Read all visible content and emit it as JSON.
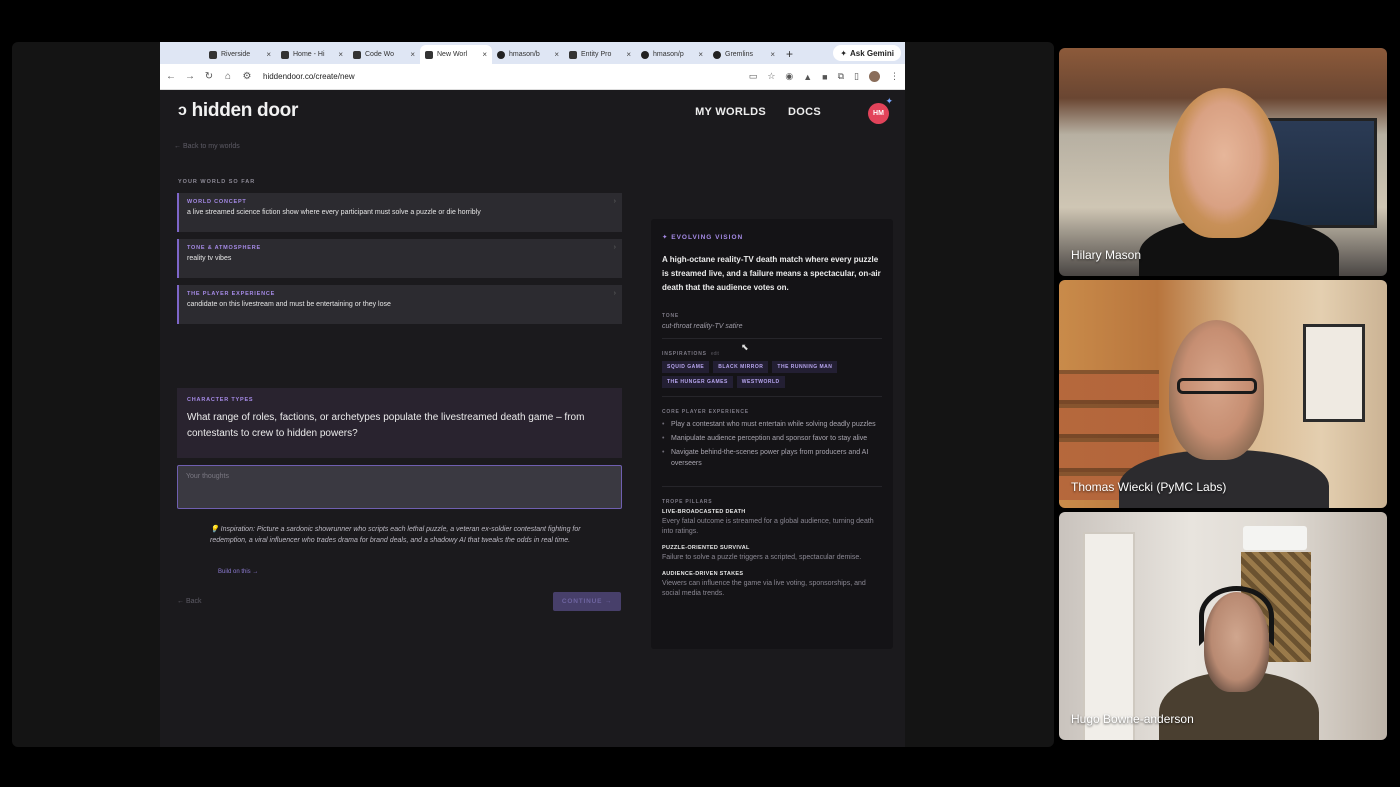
{
  "browser": {
    "tabs": [
      {
        "label": "Riverside",
        "active": false,
        "icon": "riverside-icon"
      },
      {
        "label": "Home - Hi",
        "active": false,
        "icon": "page-icon"
      },
      {
        "label": "Code Wo",
        "active": false,
        "icon": "page-icon"
      },
      {
        "label": "New Worl",
        "active": true,
        "icon": "page-icon"
      },
      {
        "label": "hmason/b",
        "active": false,
        "icon": "github-icon"
      },
      {
        "label": "Entity Pro",
        "active": false,
        "icon": "page-icon"
      },
      {
        "label": "hmason/p",
        "active": false,
        "icon": "github-icon"
      },
      {
        "label": "Gremlins",
        "active": false,
        "icon": "github-icon"
      }
    ],
    "new_tab": "+",
    "gemini_label": "Ask Gemini",
    "url": "hiddendoor.co/create/new"
  },
  "site": {
    "logo": "hidden door",
    "nav": [
      "MY WORLDS",
      "DOCS"
    ],
    "avatar_initials": "HM",
    "back_to_worlds": "← Back to my worlds",
    "so_far_label": "YOUR WORLD SO FAR",
    "cards": [
      {
        "label": "WORLD CONCEPT",
        "value": "a live streamed science fiction show where every participant must solve a puzzle or die horribly"
      },
      {
        "label": "TONE & ATMOSPHERE",
        "value": "reality tv vibes"
      },
      {
        "label": "THE PLAYER EXPERIENCE",
        "value": "candidate on this livestream and must be entertaining or they lose"
      }
    ],
    "character": {
      "label": "CHARACTER TYPES",
      "question": "What range of roles, factions, or archetypes populate the livestreamed death game – from contestants to crew to hidden powers?"
    },
    "thoughts_placeholder": "Your thoughts",
    "inspiration": "💡 Inspiration: Picture a sardonic showrunner who scripts each lethal puzzle, a veteran ex-soldier contestant fighting for redemption, a viral influencer who trades drama for brand deals, and a shadowy AI that tweaks the odds in real time.",
    "build_on": "Build on this →",
    "back": "← Back",
    "continue": "CONTINUE →"
  },
  "vision": {
    "heading": "✦ EVOLVING VISION",
    "description": "A high-octane reality-TV death match where every puzzle is streamed live, and a failure means a spectacular, on-air death that the audience votes on.",
    "tone_label": "TONE",
    "tone": "cut-throat reality-TV satire",
    "inspirations_label": "INSPIRATIONS",
    "inspirations_edit": "edit",
    "inspirations": [
      "SQUID GAME",
      "BLACK MIRROR",
      "THE RUNNING MAN",
      "THE HUNGER GAMES",
      "WESTWORLD"
    ],
    "core_label": "CORE PLAYER EXPERIENCE",
    "core": [
      "Play a contestant who must entertain while solving deadly puzzles",
      "Manipulate audience perception and sponsor favor to stay alive",
      "Navigate behind-the-scenes power plays from producers and AI overseers"
    ],
    "pillars_label": "TROPE PILLARS",
    "pillars": [
      {
        "title": "LIVE-BROADCASTED DEATH",
        "desc": "Every fatal outcome is streamed for a global audience, turning death into ratings."
      },
      {
        "title": "PUZZLE-ORIENTED SURVIVAL",
        "desc": "Failure to solve a puzzle triggers a scripted, spectacular demise."
      },
      {
        "title": "AUDIENCE-DRIVEN STAKES",
        "desc": "Viewers can influence the game via live voting, sponsorships, and social media trends."
      }
    ]
  },
  "participants": [
    {
      "name": "Hilary Mason"
    },
    {
      "name": "Thomas Wiecki (PyMC Labs)"
    },
    {
      "name": "Hugo Bowne-anderson"
    }
  ]
}
